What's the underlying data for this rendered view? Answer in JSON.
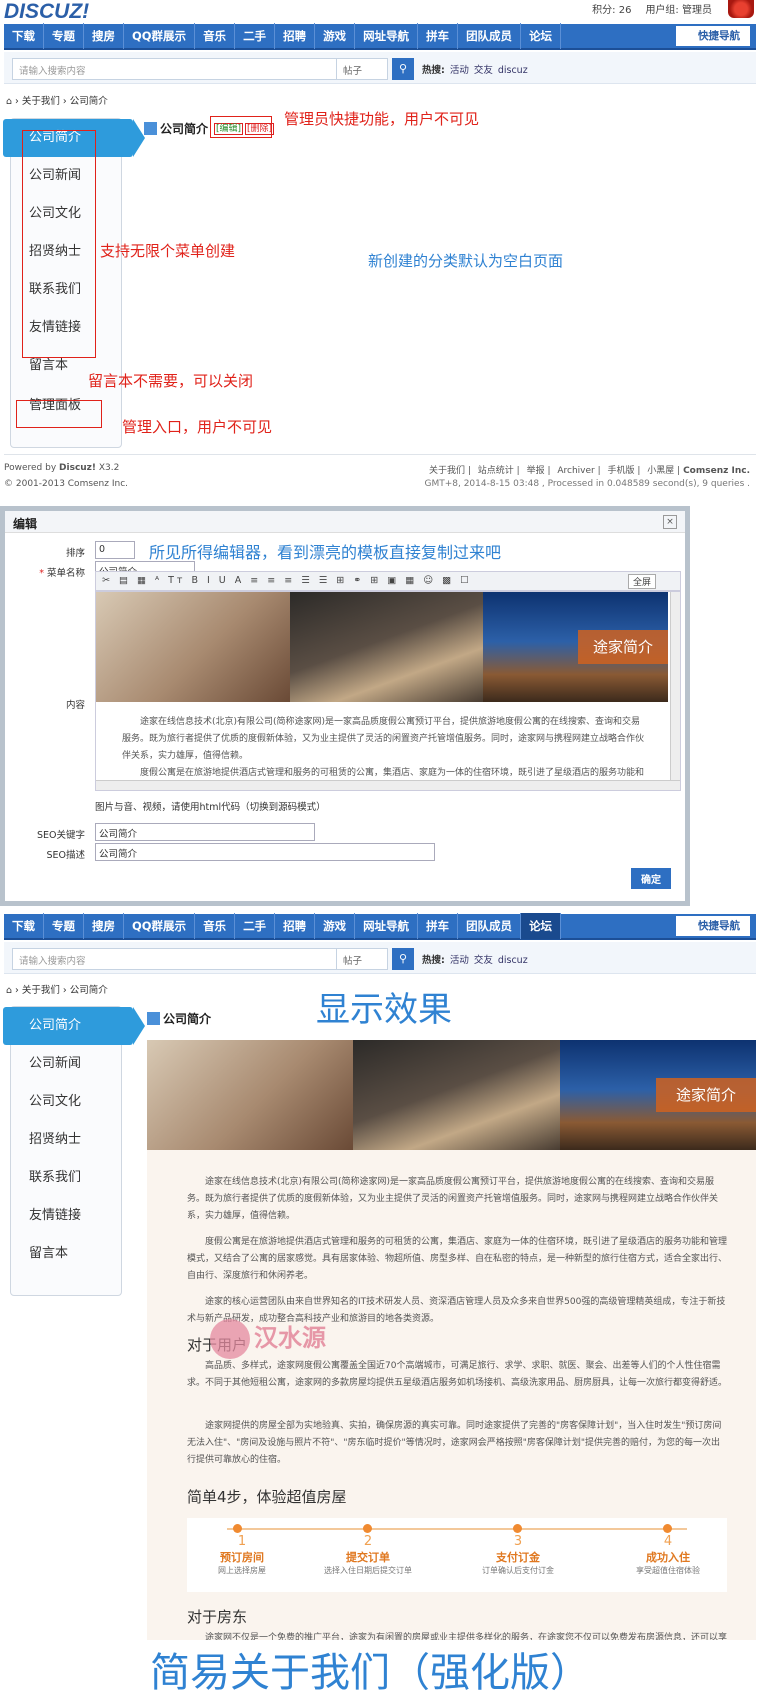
{
  "site": {
    "logo": "DISCUZ!",
    "points": "积分: 26",
    "usergroup": "用户组: 管理员"
  },
  "nav": {
    "items": [
      "下载",
      "专题",
      "搜房",
      "QQ群展示",
      "音乐",
      "二手",
      "招聘",
      "游戏",
      "网址导航",
      "拼车",
      "团队成员",
      "论坛"
    ],
    "quick": "快捷导航"
  },
  "search": {
    "placeholder": "请输入搜索内容",
    "scope": "帖子",
    "hot_label": "热搜:",
    "hot_items": [
      "活动",
      "交友",
      "discuz"
    ]
  },
  "breadcrumb": {
    "home": "关于我们",
    "current": "公司简介"
  },
  "sidebar": {
    "items": [
      "公司简介",
      "公司新闻",
      "公司文化",
      "招贤纳士",
      "联系我们",
      "友情链接",
      "留言本"
    ],
    "admin": "管理面板"
  },
  "page": {
    "title": "公司简介",
    "edit": "[编辑]",
    "delete": "[删除]"
  },
  "annotations": {
    "admin_quick": "管理员快捷功能，用户不可见",
    "unlimited": "支持无限个菜单创建",
    "blank_page": "新创建的分类默认为空白页面",
    "guestbook": "留言本不需要，可以关闭",
    "admin_entry": "管理入口，用户不可见",
    "wysiwyg": "所见所得编辑器，看到漂亮的模板直接复制过来吧",
    "display": "显示效果",
    "bottom": "简易关于我们（强化版）"
  },
  "footer": {
    "powered": "Powered by ",
    "brand": "Discuz!",
    "version": " X3.2",
    "copyright": "© 2001-2013 Comsenz Inc.",
    "links": [
      "关于我们",
      "站点统计",
      "举报",
      "Archiver",
      "手机版",
      "小黑屋"
    ],
    "company": "Comsenz Inc.",
    "stats": "GMT+8, 2014-8-15 03:48 , Processed in 0.048589 second(s), 9 queries ."
  },
  "dialog": {
    "title": "编辑",
    "close": "×",
    "sort_label": "排序",
    "sort_value": "0",
    "name_label": "菜单名称",
    "name_value": "公司简介",
    "content_label": "内容",
    "toolbar": "✂ ▤ ▦ ᴬ Tт B I U A ≡ ≡ ≡ ☰ ☰ ⊞ ⚭ ⊞ ▣ ▦ ☺ ▩ ☐",
    "fullscreen": "全屏",
    "hint": "图片与音、视频，请使用html代码（切换到源码模式）",
    "seo_kw_label": "SEO关键字",
    "seo_kw_value": "公司简介",
    "seo_desc_label": "SEO描述",
    "seo_desc_value": "公司简介",
    "ok": "确定"
  },
  "banner": {
    "tag": "途家简介"
  },
  "article": {
    "p1": "途家在线信息技术(北京)有限公司(简称途家网)是一家高品质度假公寓预订平台，提供旅游地度假公寓的在线搜索、查询和交易服务。既为旅行者提供了优质的度假新体验，又为业主提供了灵活的闲置资产托管增值服务。同时，途家网与携程网建立战略合作伙伴关系，实力雄厚，值得信赖。",
    "p2": "度假公寓是在旅游地提供酒店式管理和服务的可租赁的公寓，集酒店、家庭为一体的住宿环境，既引进了星级酒店的服务功能和管理模式，又结合了公寓的居家感觉。具有居家体验、物超所值、房型多样、自在私密的特点，是一种新型的旅行住宿方式，适合全家出行、自由行、深度旅行和休闲养老。",
    "p3": "途家的核心运营团队由来自世界知名的IT技术研发人员、资深酒店管理人员及众多来自世界500强的高级管理精英组成，专注于新技术与新产品研发，成功整合高科技产业和旅游目的地各类资源。",
    "h_user": "对于用户",
    "p4": "高品质、多样式，途家网度假公寓覆盖全国近70个高端城市，可满足旅行、求学、求职、就医、聚会、出差等人们的个人性住宿需求。不同于其他短租公寓，途家网的多款房屋均提供五星级酒店服务如机场接机、高级洗家用品、厨房厨具，让每一次旅行都变得舒适。",
    "p5": "途家网提供的房屋全部为实地验真、实拍，确保房源的真实可靠。同时途家提供了完善的\"房客保障计划\"，当入住时发生\"预订房间无法入住\"、\"房间及设施与照片不符\"、\"房东临时提价\"等情况时，途家网会严格按照\"房客保障计划\"提供完善的赔付，为您的每一次出行提供可靠放心的住宿。",
    "h_steps": "简单4步，体验超值房屋",
    "steps": [
      {
        "n": "1",
        "t": "预订房间",
        "s": "网上选择房屋"
      },
      {
        "n": "2",
        "t": "提交订单",
        "s": "选择入住日期后提交订单"
      },
      {
        "n": "3",
        "t": "支付订金",
        "s": "订单确认后支付订金"
      },
      {
        "n": "4",
        "t": "成功入住",
        "s": "享受超值住宿体验"
      }
    ],
    "h_owner": "对于房东",
    "p6": "途家网不仅是一个免费的推广平台，途家为有闲置的房屋或业主提供多样化的服务，在途家您不仅可以免费发布房源信息，还可以享受途家提供的托管服务，途家网严格按照“房客保障计划”为您的房屋提供保障。>>进入途家房东中心了解更多"
  },
  "watermark": {
    "text": "汉水源"
  }
}
